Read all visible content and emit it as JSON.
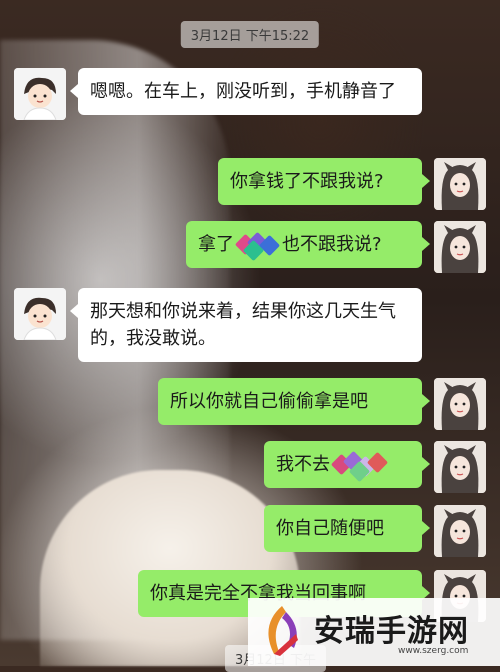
{
  "timestamps": [
    "3月12日 下午15:22",
    "3月12日 下午"
  ],
  "messages": [
    {
      "side": "left",
      "text": "嗯嗯。在车上，刚没听到，手机静音了"
    },
    {
      "side": "right",
      "text": "你拿钱了不跟我说?"
    },
    {
      "side": "right",
      "before": "拿了",
      "after": "也不跟我说?"
    },
    {
      "side": "left",
      "text": "那天想和你说来着，结果你这几天生气的，我没敢说。"
    },
    {
      "side": "right",
      "text": "所以你就自己偷偷拿是吧"
    },
    {
      "side": "right",
      "before": "我不去",
      "after": ""
    },
    {
      "side": "right",
      "text": "你自己随便吧"
    },
    {
      "side": "right",
      "text": "你真是完全不拿我当回事啊"
    }
  ],
  "watermark": {
    "brand": "安瑞手游网",
    "url": "www.szerg.com"
  },
  "colors": {
    "bubble_self": "#95ec69",
    "bubble_other": "#ffffff"
  }
}
